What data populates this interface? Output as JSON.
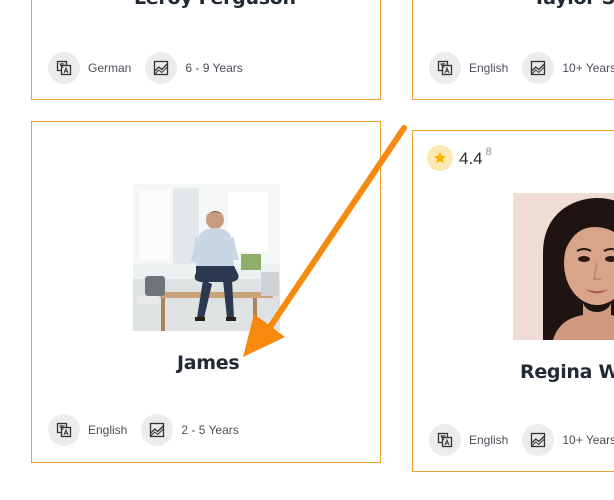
{
  "cards": {
    "top_left": {
      "name": "Leroy Ferguson",
      "language": "German",
      "experience": "6 - 9 Years"
    },
    "top_right": {
      "name": "Taylor Sw",
      "language": "English",
      "experience": "10+ Years"
    },
    "bottom_left": {
      "name": "James",
      "language": "English",
      "experience": "2 - 5 Years"
    },
    "bottom_right": {
      "name": "Regina Wa",
      "rating": "4.4",
      "rating_count": "8",
      "language": "English",
      "experience": "10+ Years"
    }
  },
  "icons": {
    "language": "translate-icon",
    "experience": "chart-icon",
    "rating": "star-icon",
    "annotation": "arrow-pointer"
  },
  "colors": {
    "card_border": "#f0a033",
    "annotation_arrow": "#f7890d",
    "star": "#f5b400"
  }
}
